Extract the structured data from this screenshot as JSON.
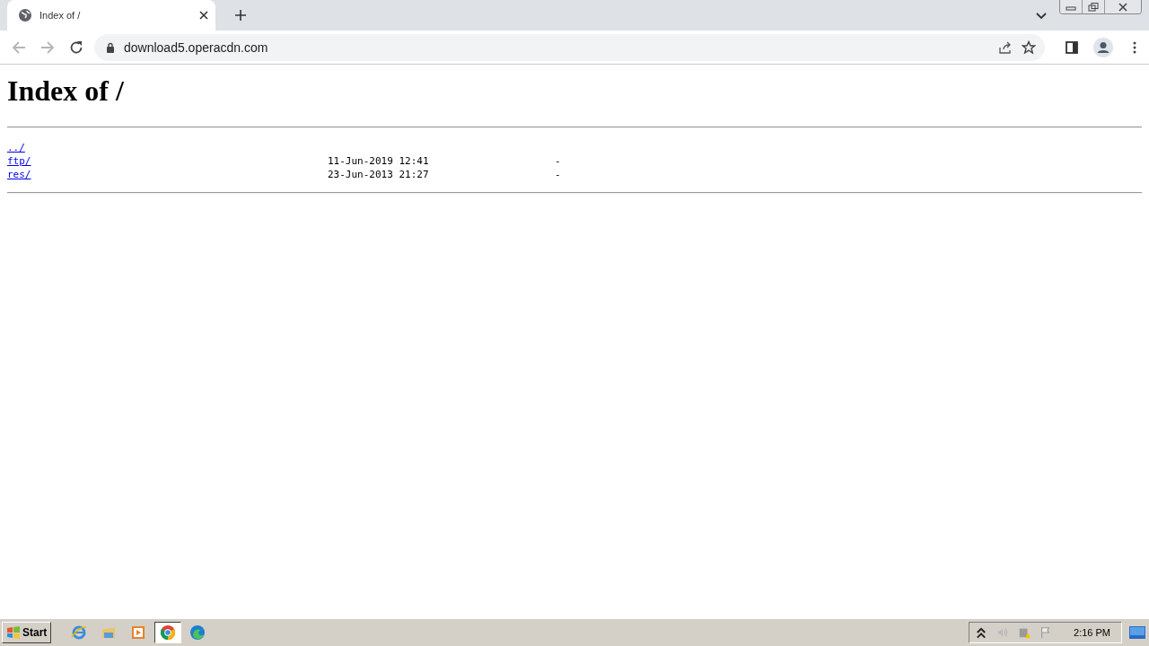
{
  "browser": {
    "tab": {
      "title": "Index of /",
      "selected": true
    },
    "address": "download5.operacdn.com"
  },
  "page": {
    "heading": "Index of /",
    "entries": [
      {
        "name": "../"
      },
      {
        "name": "ftp/",
        "modified": "11-Jun-2019 12:41",
        "size": "-"
      },
      {
        "name": "res/",
        "modified": "23-Jun-2013 21:27",
        "size": "-"
      }
    ]
  },
  "taskbar": {
    "start": "Start",
    "apps": [
      {
        "kind": "ie",
        "selected": false
      },
      {
        "kind": "folder",
        "selected": false
      },
      {
        "kind": "media",
        "selected": false
      },
      {
        "kind": "chrome",
        "selected": true
      },
      {
        "kind": "edge",
        "selected": false
      }
    ],
    "clock": "2:16 PM"
  }
}
